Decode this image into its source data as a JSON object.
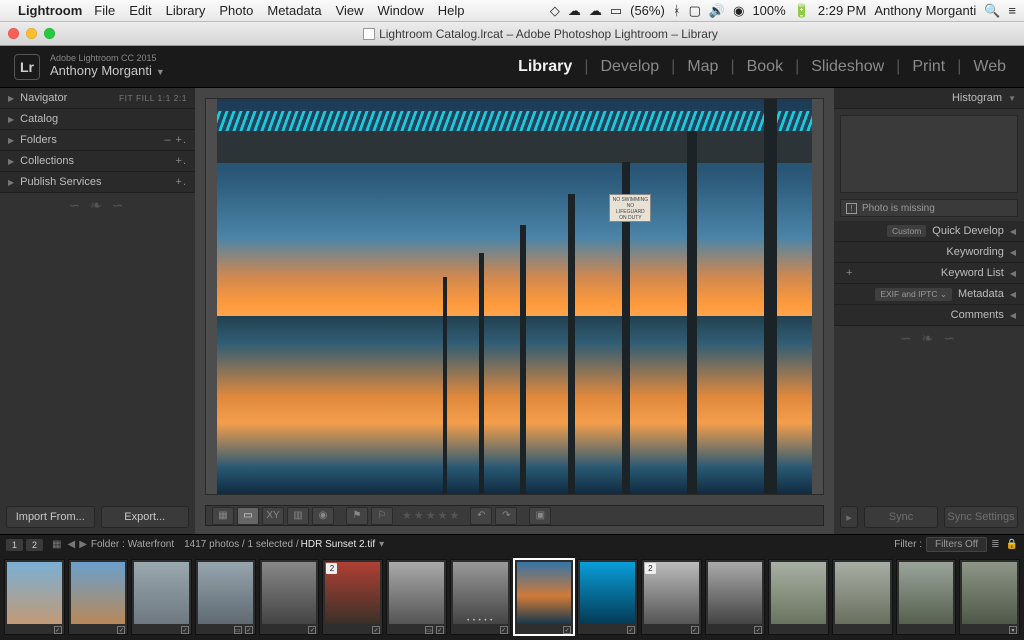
{
  "mac_menu": {
    "app": "Lightroom",
    "items": [
      "File",
      "Edit",
      "Library",
      "Photo",
      "Metadata",
      "View",
      "Window",
      "Help"
    ],
    "battery": "(56%)",
    "battery_pct": "100%",
    "time": "2:29 PM",
    "user": "Anthony Morganti"
  },
  "window": {
    "title": "Lightroom Catalog.lrcat – Adobe Photoshop Lightroom – Library"
  },
  "identity": {
    "line1": "Adobe Lightroom CC 2015",
    "line2": "Anthony Morganti"
  },
  "modules": [
    "Library",
    "Develop",
    "Map",
    "Book",
    "Slideshow",
    "Print",
    "Web"
  ],
  "active_module": "Library",
  "left_panels": {
    "navigator": {
      "label": "Navigator",
      "extra": "FIT   FILL   1:1   2:1"
    },
    "catalog": "Catalog",
    "folders": "Folders",
    "collections": "Collections",
    "publish": "Publish Services",
    "import_btn": "Import From...",
    "export_btn": "Export..."
  },
  "right_panels": {
    "histogram": "Histogram",
    "warning": "Photo is missing",
    "quick_develop": "Quick Develop",
    "quick_develop_left": "Custom",
    "keywording": "Keywording",
    "keyword_list": "Keyword List",
    "metadata": "Metadata",
    "metadata_preset": "EXIF and IPTC",
    "comments": "Comments",
    "sync_btn": "Sync",
    "sync_settings_btn": "Sync Settings"
  },
  "filmstrip_header": {
    "screen1": "1",
    "screen2": "2",
    "folder_label": "Folder :",
    "folder_name": "Waterfront",
    "count": "1417 photos / 1 selected /",
    "filename": "HDR Sunset 2.tif",
    "filter_label": "Filter :",
    "filter_value": "Filters Off"
  },
  "main_image": {
    "sign_line1": "NO SWIMMING",
    "sign_line2": "NO LIFEGUARD",
    "sign_line3": "ON DUTY"
  }
}
